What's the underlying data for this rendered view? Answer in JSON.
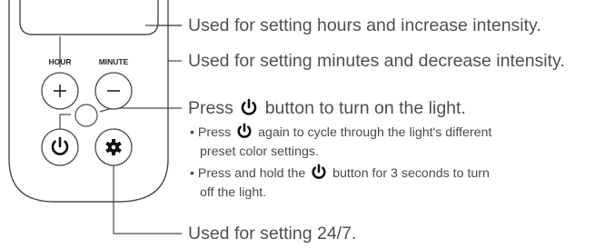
{
  "remote": {
    "hour_label": "HOUR",
    "minute_label": "MINUTE"
  },
  "callouts": {
    "hours": "Used for setting hours and increase intensity.",
    "minutes": "Used for setting minutes and decrease intensity.",
    "power_prefix": "Press",
    "power_suffix": "button to turn on the light.",
    "note1_prefix": "Press",
    "note1_suffix": "again to cycle through the light's different",
    "note1_line2": "preset color settings.",
    "note2_prefix": "Press and hold the",
    "note2_suffix": "button for 3 seconds to turn",
    "note2_line2": "off the light.",
    "settings": "Used for setting 24/7."
  },
  "colors": {
    "line": "#4a4a4a",
    "text": "#4f4f4f",
    "icon": "#111111"
  }
}
